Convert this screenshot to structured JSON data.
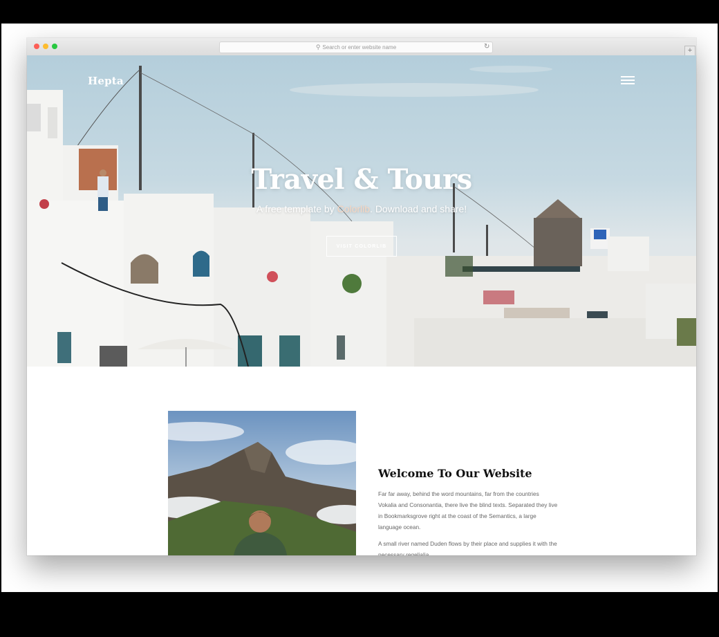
{
  "browser": {
    "url_placeholder": "Search or enter website name",
    "new_tab_label": "+"
  },
  "site": {
    "logo": "Hepta",
    "hero": {
      "title": "Travel & Tours",
      "subtitle_prefix": "A free template by ",
      "subtitle_link": "Colorlib",
      "subtitle_suffix": ". Download and share!",
      "button_label": "VISIT COLORLIB"
    },
    "about": {
      "heading": "Welcome To Our Website",
      "paragraph1": "Far far away, behind the word mountains, far from the countries Vokalia and Consonantia, there live the blind texts. Separated they live in Bookmarksgrove right at the coast of the Semantics, a large language ocean.",
      "paragraph2": "A small river named Duden flows by their place and supplies it with the necessary regelialia."
    }
  },
  "colors": {
    "accent_link": "#f6d6c2",
    "window_chrome": "#dcdcdc",
    "heading": "#111111",
    "body_text": "#666666"
  }
}
